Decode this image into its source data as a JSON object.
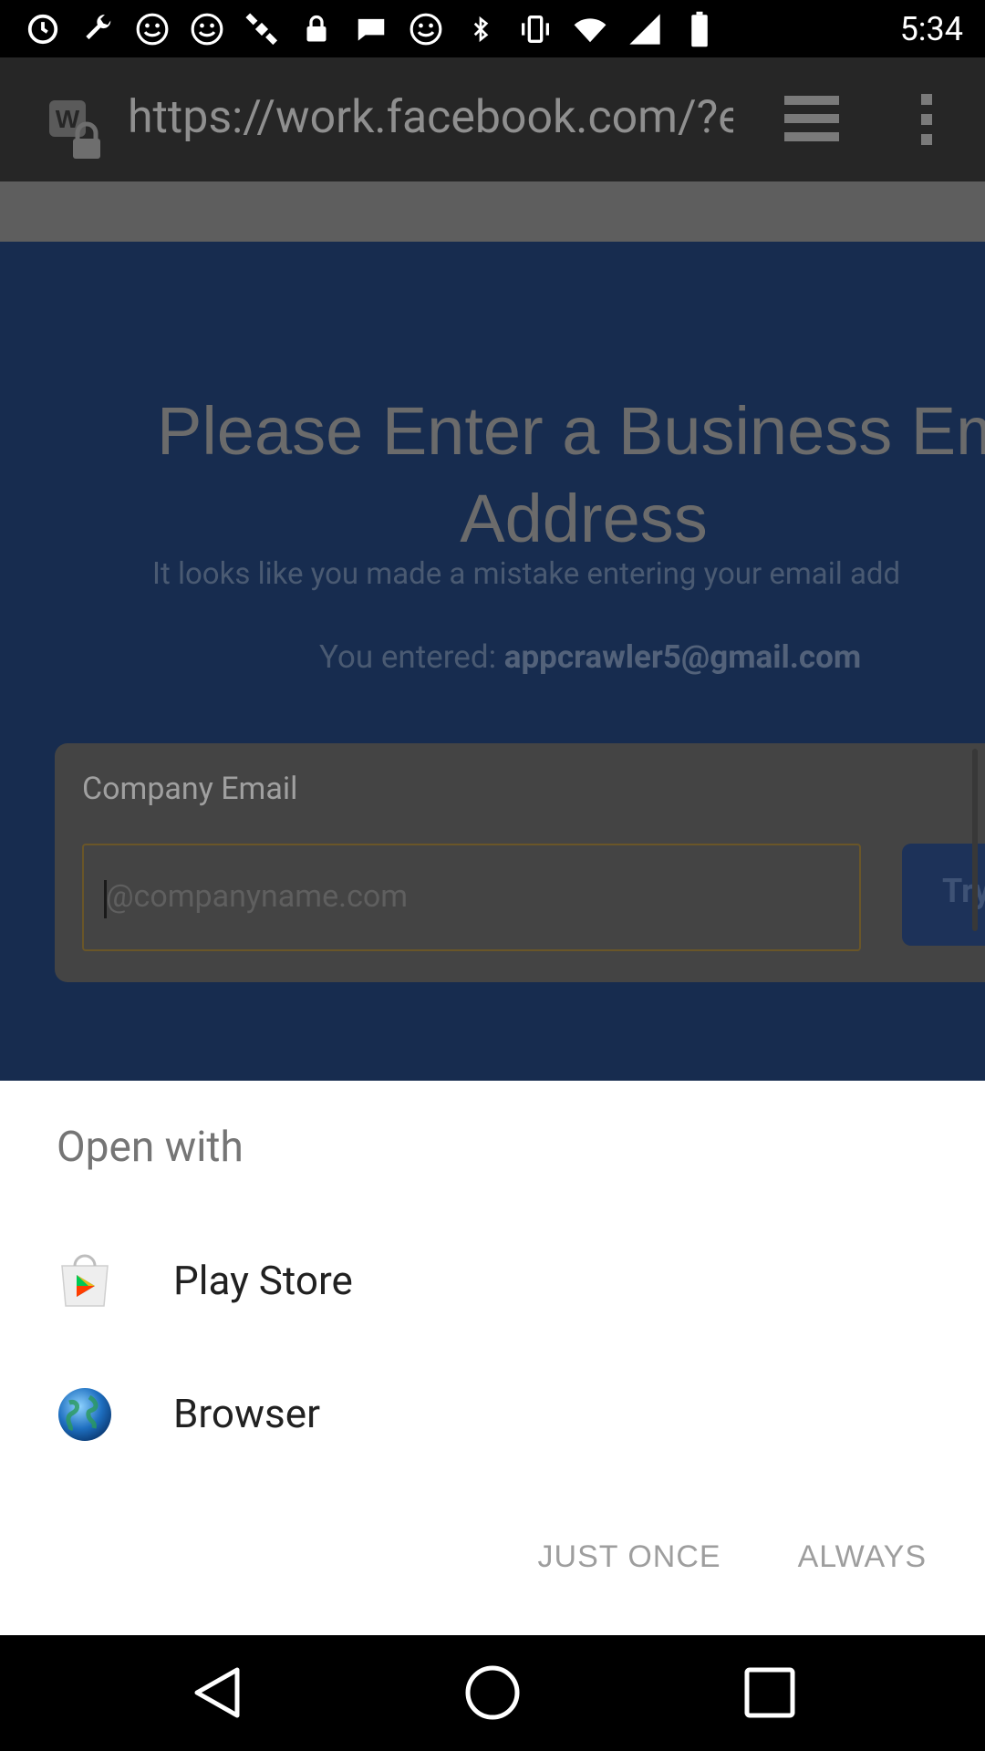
{
  "status_bar": {
    "time": "5:34",
    "left_icons": [
      "sync-icon",
      "wrench-icon",
      "emoji-icon",
      "emoji-icon",
      "satellite-icon",
      "lock-icon",
      "chat-icon",
      "emoji-icon",
      "bluetooth-icon",
      "vibrate-icon",
      "wifi-icon",
      "signal-icon",
      "battery-icon"
    ]
  },
  "browser": {
    "url": "https://work.facebook.com/?em"
  },
  "page": {
    "title_line1": "Please Enter a Business Em",
    "title_line2": "Address",
    "subtitle": "It looks like you made a mistake entering your email add",
    "entered_prefix": "You entered: ",
    "entered_email": "appcrawler5@gmail.com",
    "card_label": "Company Email",
    "input_placeholder": "@companyname.com",
    "try_button": "Try"
  },
  "sheet": {
    "title": "Open with",
    "apps": [
      {
        "label": "Play Store",
        "icon": "play-store-icon"
      },
      {
        "label": "Browser",
        "icon": "browser-globe-icon"
      }
    ],
    "just_once": "JUST ONCE",
    "always": "ALWAYS"
  },
  "nav": {
    "back": "back-icon",
    "home": "home-icon",
    "recent": "recent-apps-icon"
  }
}
